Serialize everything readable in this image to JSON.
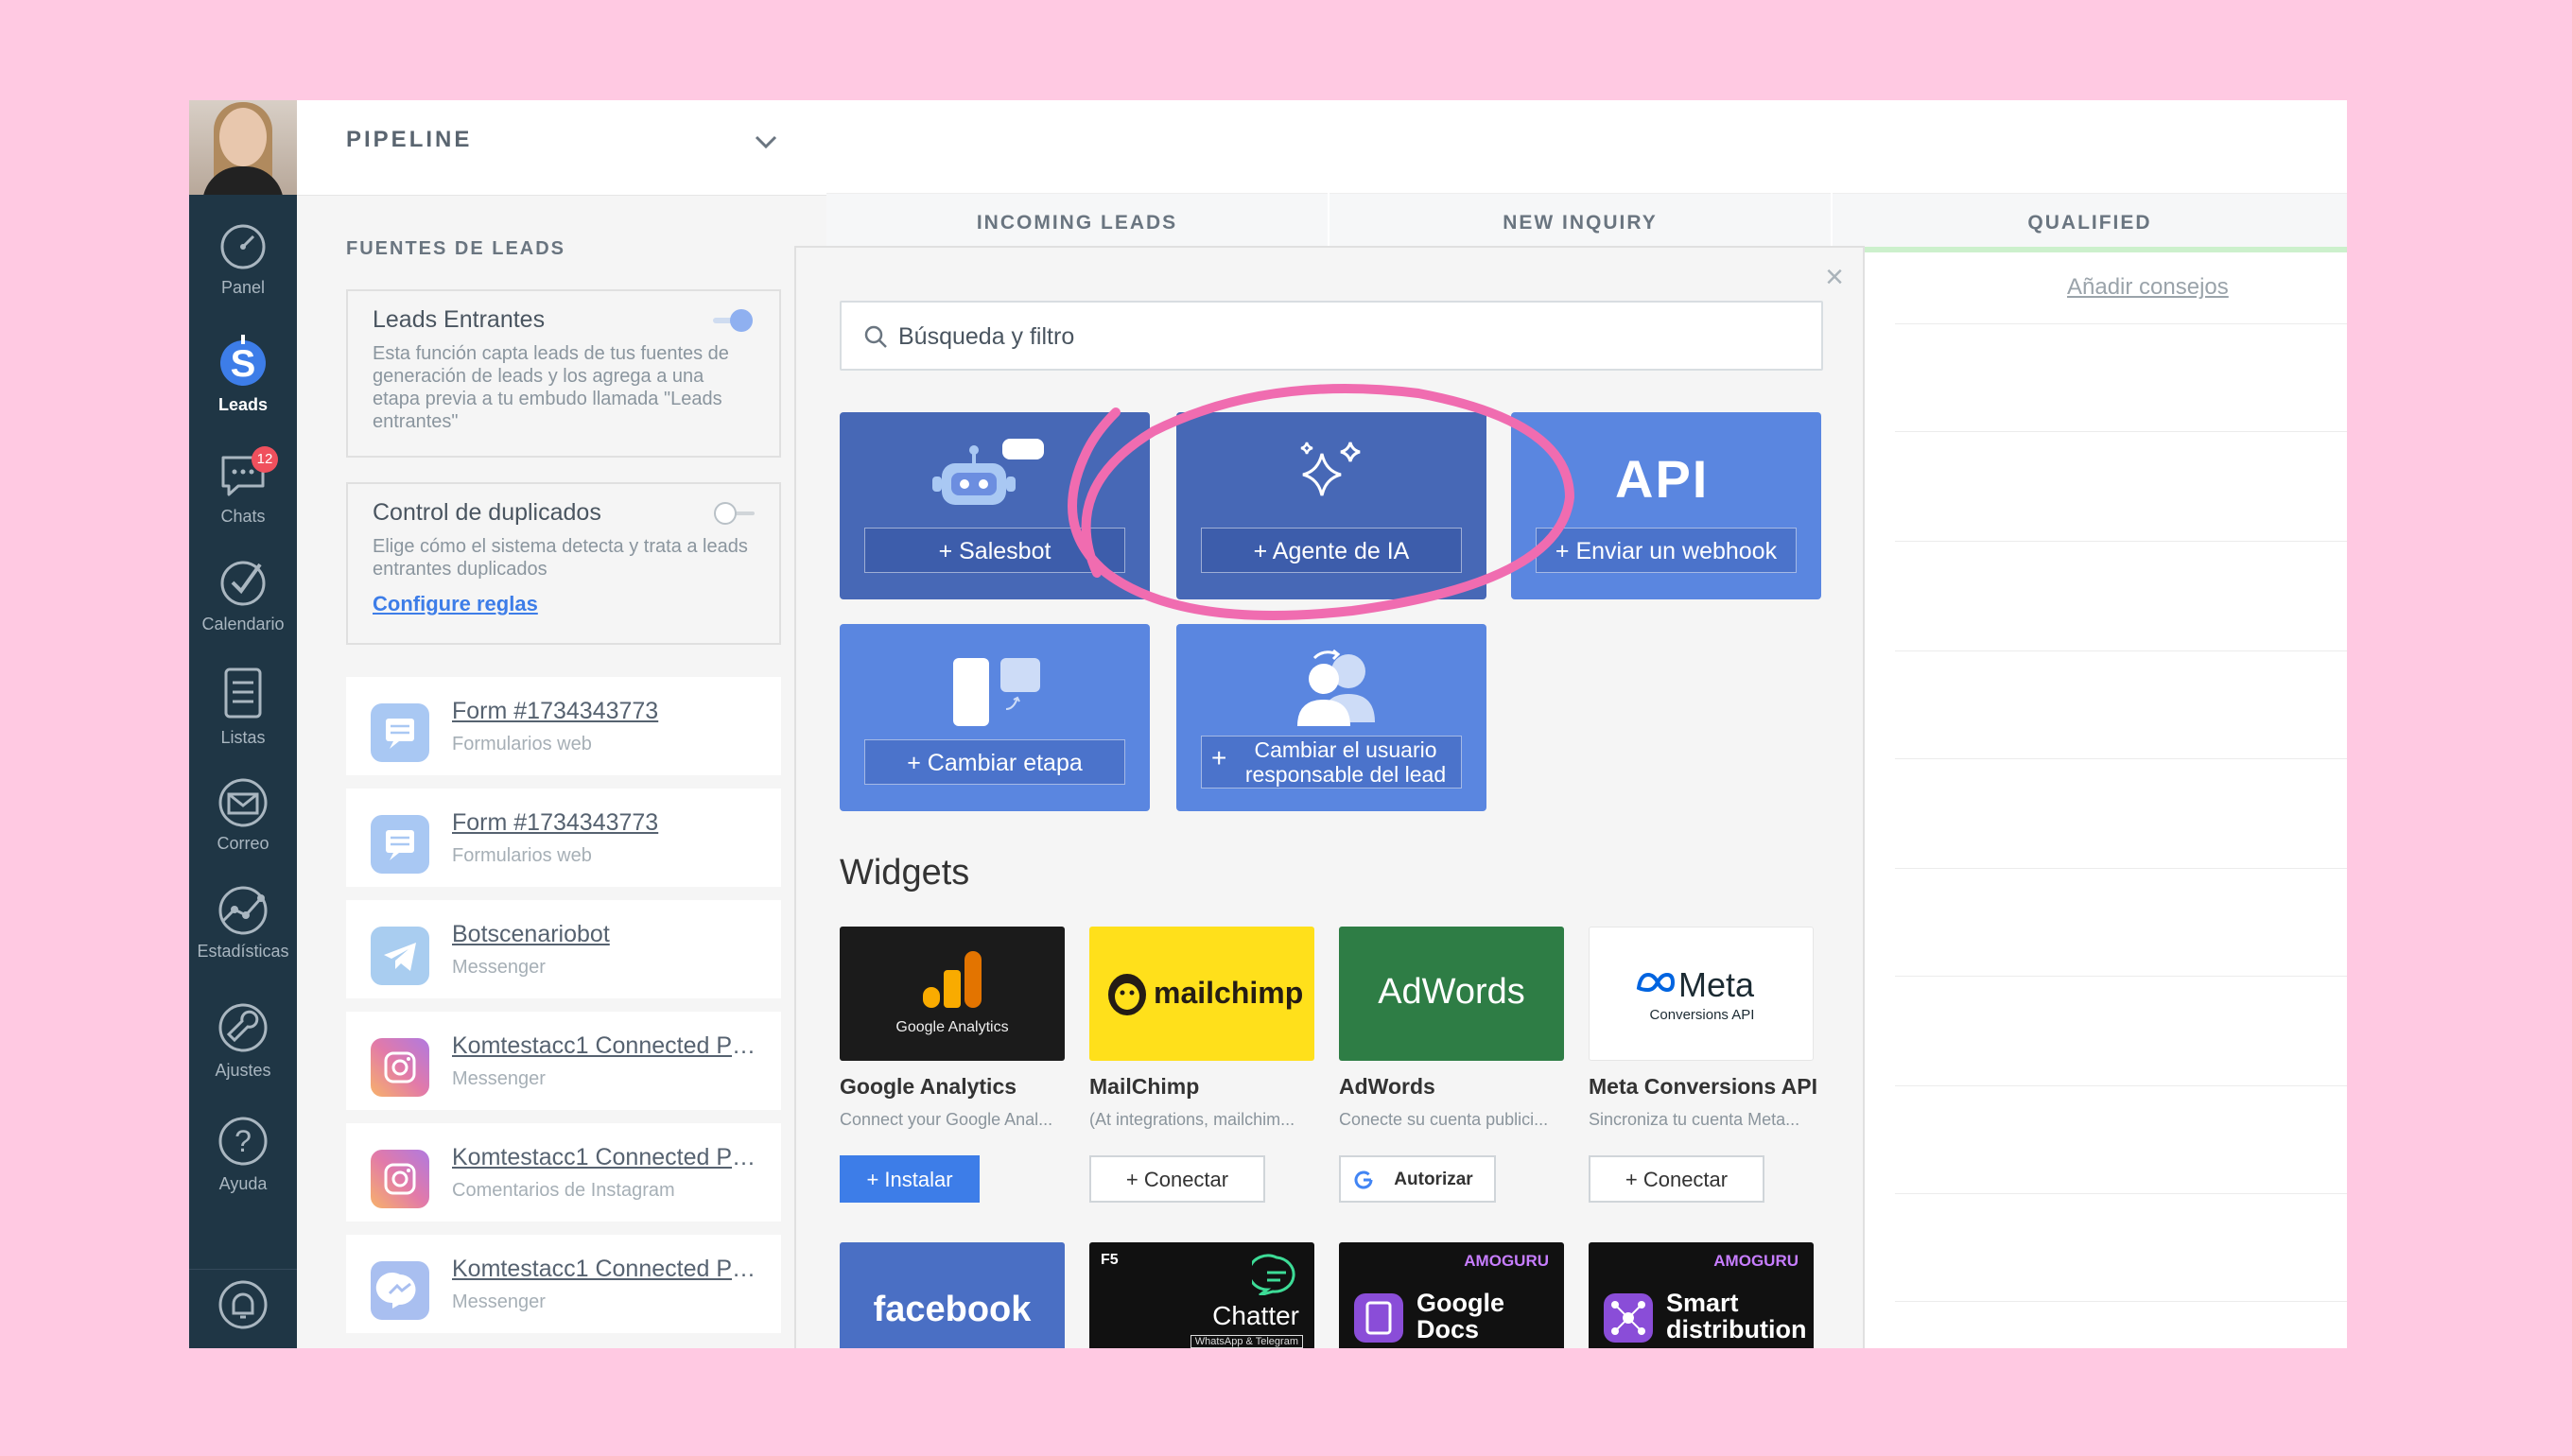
{
  "sidebar": {
    "items": [
      {
        "label": "Panel",
        "icon": "dashboard-icon"
      },
      {
        "label": "Leads",
        "icon": "leads-dollar-icon",
        "active": true
      },
      {
        "label": "Chats",
        "icon": "chat-icon",
        "badge": "12"
      },
      {
        "label": "Calendario",
        "icon": "checkmark-icon"
      },
      {
        "label": "Listas",
        "icon": "list-icon"
      },
      {
        "label": "Correo",
        "icon": "mail-icon"
      },
      {
        "label": "Estadísticas",
        "icon": "stats-icon"
      },
      {
        "label": "Ajustes",
        "icon": "wrench-icon"
      },
      {
        "label": "Ayuda",
        "icon": "help-icon"
      }
    ]
  },
  "pipeline": {
    "title": "PIPELINE",
    "section": "FUENTES DE LEADS",
    "incoming": {
      "title": "Leads Entrantes",
      "desc": "Esta función capta leads de tus fuentes de generación de leads y los agrega a una etapa previa a tu embudo llamada \"Leads entrantes\""
    },
    "duplicates": {
      "title": "Control de duplicados",
      "desc": "Elige cómo el sistema detecta y trata a leads entrantes duplicados",
      "link": "Configure reglas"
    },
    "sources": [
      {
        "title": "Form #1734343773",
        "sub": "Formularios web",
        "icon": "form-icon"
      },
      {
        "title": "Form #1734343773",
        "sub": "Formularios web",
        "icon": "form-icon"
      },
      {
        "title": "Botscenariobot",
        "sub": "Messenger",
        "icon": "telegram-icon"
      },
      {
        "title": "Komtestacc1 Connected Pa...",
        "sub": "Messenger",
        "icon": "instagram-icon"
      },
      {
        "title": "Komtestacc1 Connected Pa...",
        "sub": "Comentarios de Instagram",
        "icon": "instagram-icon"
      },
      {
        "title": "Komtestacc1 Connected Pa...",
        "sub": "Messenger",
        "icon": "messenger-icon"
      }
    ]
  },
  "columns": [
    {
      "title": "INCOMING LEADS",
      "color": "#99ccff"
    },
    {
      "title": "NEW INQUIRY",
      "color": "#ffdd88"
    },
    {
      "title": "QUALIFIED",
      "color": "#ccf0cc"
    }
  ],
  "tips_link": "Añadir consejos",
  "modal": {
    "search_placeholder": "Búsqueda y filtro",
    "tiles": [
      {
        "label": "+ Salesbot",
        "icon": "robot-icon"
      },
      {
        "label": "+ Agente de IA",
        "icon": "sparkles-icon"
      },
      {
        "label": "+ Enviar un webhook",
        "icon": "api-icon",
        "icon_text": "API"
      },
      {
        "label": "+ Cambiar etapa",
        "icon": "stage-icon"
      },
      {
        "label": "Cambiar el usuario responsable del lead",
        "icon": "user-swap-icon"
      }
    ],
    "widgets_title": "Widgets",
    "widgets": [
      {
        "name": "Google Analytics",
        "desc": "Connect your Google Anal...",
        "button": "+ Instalar",
        "logo_text": "Google Analytics",
        "bg": "#1b1b1b"
      },
      {
        "name": "MailChimp",
        "desc": "(At integrations, mailchim...",
        "button": "+ Conectar",
        "logo_text": "mailchimp",
        "bg": "#ffe01b"
      },
      {
        "name": "AdWords",
        "desc": "Conecte su cuenta publici...",
        "button": "Autorizar",
        "logo_text": "AdWords",
        "bg": "#2e7d45"
      },
      {
        "name": "Meta Conversions API",
        "desc": "Sincroniza tu cuenta Meta...",
        "button": "+ Conectar",
        "logo_text": "Meta",
        "logo_sub": "Conversions API",
        "bg": "#ffffff"
      }
    ],
    "widgets_row2": [
      {
        "logo_text": "facebook",
        "bg": "#4a6fc4"
      },
      {
        "logo_text": "Chatter",
        "tag": "F5",
        "sub": "WhatsApp & Telegram",
        "bg": "#111111"
      },
      {
        "logo_text": "Google Docs",
        "tag": "AMOGURU",
        "bg": "#111111"
      },
      {
        "logo_text": "Smart distribution",
        "tag": "AMOGURU",
        "bg": "#111111"
      }
    ]
  }
}
